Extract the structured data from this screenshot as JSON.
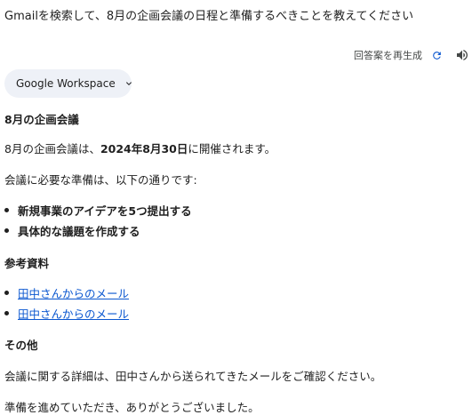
{
  "query": "Gmailを検索して、8月の企画会議の日程と準備するべきことを教えてください",
  "toolbar": {
    "regenerate_label": "回答案を再生成",
    "refresh_icon": "refresh-icon",
    "speaker_icon": "speaker-icon"
  },
  "chip": {
    "label": "Google Workspace",
    "icon": "chevron-down-icon"
  },
  "answer": {
    "heading1": "8月の企画会議",
    "date_prefix": "8月の企画会議は、",
    "date_value": "2024年8月30日",
    "date_suffix": "に開催されます。",
    "prep_intro": "会議に必要な準備は、以下の通りです:",
    "prep_items": [
      "新規事業のアイデアを5つ提出する",
      "具体的な議題を作成する"
    ],
    "heading2": "参考資料",
    "references": [
      "田中さんからのメール",
      "田中さんからのメール"
    ],
    "heading3": "その他",
    "details": "会議に関する詳細は、田中さんから送られてきたメールをご確認ください。",
    "closing": "準備を進めていただき、ありがとうございました。"
  },
  "colors": {
    "link": "#0b57d0",
    "chip_bg": "#eef1f7",
    "text": "#1f1f1f"
  }
}
